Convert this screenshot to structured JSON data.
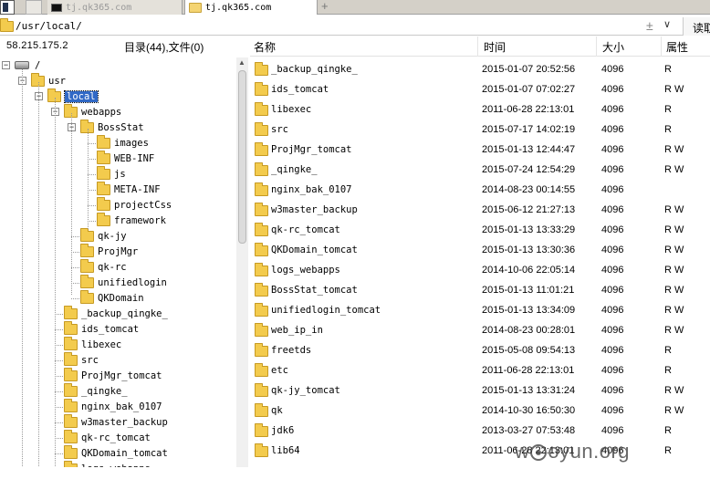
{
  "tabs": [
    {
      "label": "tj.qk365.com",
      "active": false
    },
    {
      "label": "tj.qk365.com",
      "active": true
    }
  ],
  "new_tab_symbol": "+",
  "path": {
    "value": "/usr/local/",
    "plus": "±",
    "dropdown": "∨",
    "read_button": "读取"
  },
  "info": {
    "ip": "58.215.175.2",
    "summary": "目录(44),文件(0)"
  },
  "tree": {
    "root": "/",
    "usr": "usr",
    "local": "local",
    "webapps": "webapps",
    "bossstat": "BossStat",
    "bossstat_children": [
      "images",
      "WEB-INF",
      "js",
      "META-INF",
      "projectCss",
      "framework"
    ],
    "webapps_children": [
      "qk-jy",
      "ProjMgr",
      "qk-rc",
      "unifiedlogin",
      "QKDomain"
    ],
    "local_children": [
      "_backup_qingke_",
      "ids_tomcat",
      "libexec",
      "src",
      "ProjMgr_tomcat",
      "_qingke_",
      "nginx_bak_0107",
      "w3master_backup",
      "qk-rc_tomcat",
      "QKDomain_tomcat",
      "logs_webapps"
    ]
  },
  "list": {
    "columns": {
      "name": "名称",
      "time": "时间",
      "size": "大小",
      "attr": "属性"
    },
    "rows": [
      {
        "name": "_backup_qingke_",
        "time": "2015-01-07 20:52:56",
        "size": "4096",
        "attr": "R"
      },
      {
        "name": "ids_tomcat",
        "time": "2015-01-07 07:02:27",
        "size": "4096",
        "attr": "R W"
      },
      {
        "name": "libexec",
        "time": "2011-06-28 22:13:01",
        "size": "4096",
        "attr": "R"
      },
      {
        "name": "src",
        "time": "2015-07-17 14:02:19",
        "size": "4096",
        "attr": "R"
      },
      {
        "name": "ProjMgr_tomcat",
        "time": "2015-01-13 12:44:47",
        "size": "4096",
        "attr": "R W"
      },
      {
        "name": "_qingke_",
        "time": "2015-07-24 12:54:29",
        "size": "4096",
        "attr": "R W"
      },
      {
        "name": "nginx_bak_0107",
        "time": "2014-08-23 00:14:55",
        "size": "4096",
        "attr": ""
      },
      {
        "name": "w3master_backup",
        "time": "2015-06-12 21:27:13",
        "size": "4096",
        "attr": "R W"
      },
      {
        "name": "qk-rc_tomcat",
        "time": "2015-01-13 13:33:29",
        "size": "4096",
        "attr": "R W"
      },
      {
        "name": "QKDomain_tomcat",
        "time": "2015-01-13 13:30:36",
        "size": "4096",
        "attr": "R W"
      },
      {
        "name": "logs_webapps",
        "time": "2014-10-06 22:05:14",
        "size": "4096",
        "attr": "R W"
      },
      {
        "name": "BossStat_tomcat",
        "time": "2015-01-13 11:01:21",
        "size": "4096",
        "attr": "R W"
      },
      {
        "name": "unifiedlogin_tomcat",
        "time": "2015-01-13 13:34:09",
        "size": "4096",
        "attr": "R W"
      },
      {
        "name": "web_ip_in",
        "time": "2014-08-23 00:28:01",
        "size": "4096",
        "attr": "R W"
      },
      {
        "name": "freetds",
        "time": "2015-05-08 09:54:13",
        "size": "4096",
        "attr": "R"
      },
      {
        "name": "etc",
        "time": "2011-06-28 22:13:01",
        "size": "4096",
        "attr": "R"
      },
      {
        "name": "qk-jy_tomcat",
        "time": "2015-01-13 13:31:24",
        "size": "4096",
        "attr": "R W"
      },
      {
        "name": "qk",
        "time": "2014-10-30 16:50:30",
        "size": "4096",
        "attr": "R W"
      },
      {
        "name": "jdk6",
        "time": "2013-03-27 07:53:48",
        "size": "4096",
        "attr": "R"
      },
      {
        "name": "lib64",
        "time": "2011-06-28 22:13:01",
        "size": "4096",
        "attr": "R"
      }
    ]
  },
  "watermark": {
    "pre": "w",
    "mid": "",
    "post": "oyun.org"
  },
  "colors": {
    "selection": "#3169c6",
    "folder": "#f3cb4d",
    "accent": "#3169c6"
  },
  "icons": {
    "folder": "folder-icon",
    "drive": "drive-icon",
    "expand": "expand-icon",
    "collapse": "collapse-icon"
  }
}
